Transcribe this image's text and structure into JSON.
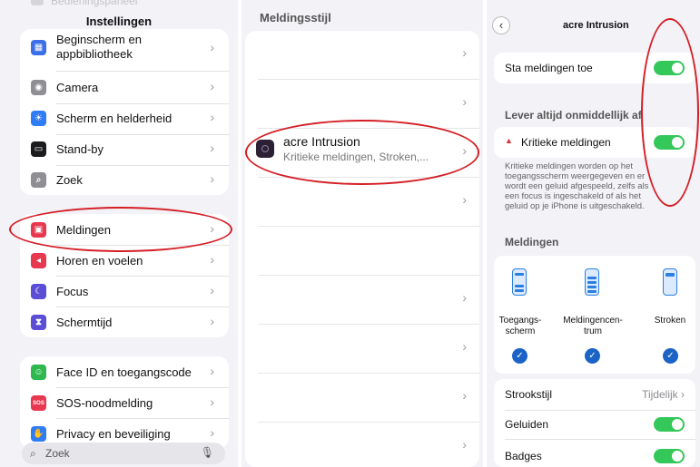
{
  "settings": {
    "ghost_item": "Bedieningspaneel",
    "title": "Instellingen",
    "group1": [
      {
        "label": "Beginscherm en appbibliotheek",
        "line1": "Beginscherm en",
        "line2": "appbibliotheek",
        "icon": "home-screen-icon",
        "color": "#3a6fe8"
      },
      {
        "label": "Camera",
        "icon": "camera-icon",
        "color": "#8e8e93"
      },
      {
        "label": "Scherm en helderheid",
        "icon": "brightness-icon",
        "color": "#2f7df6"
      },
      {
        "label": "Stand-by",
        "icon": "standby-icon",
        "color": "#1c1c1e"
      },
      {
        "label": "Zoek",
        "icon": "search-icon",
        "color": "#8e8e93"
      }
    ],
    "group2": [
      {
        "label": "Meldingen",
        "icon": "notifications-icon",
        "color": "#e8384f"
      },
      {
        "label": "Horen en voelen",
        "icon": "sound-icon",
        "color": "#e8384f"
      },
      {
        "label": "Focus",
        "icon": "moon-icon",
        "color": "#5b4ed6"
      },
      {
        "label": "Schermtijd",
        "icon": "hourglass-icon",
        "color": "#5b4ed6"
      }
    ],
    "group3": [
      {
        "label": "Face ID en toegangscode",
        "icon": "faceid-icon",
        "color": "#2fb84f"
      },
      {
        "label": "SOS-noodmelding",
        "icon": "sos-icon",
        "color": "#e8384f",
        "glyph": "SOS"
      },
      {
        "label": "Privacy en beveiliging",
        "icon": "hand-icon",
        "color": "#2f7df6"
      }
    ],
    "search_placeholder": "Zoek"
  },
  "notification_style": {
    "title": "Meldingsstijl",
    "app": {
      "name": "acre  Intrusion",
      "subtitle": "Kritieke meldingen, Stroken,..."
    }
  },
  "app_settings": {
    "title": "acre  Intrusion",
    "allow_label": "Sta meldingen toe",
    "deliver_header": "Lever altijd onmiddellijk af",
    "critical_label": "Kritieke meldingen",
    "critical_note_lines": [
      "Kritieke meldingen worden op het",
      "toegangsscherm weergegeven en er",
      "wordt een geluid afgespeeld, zelfs als",
      "een focus is ingeschakeld of als het",
      "geluid op je iPhone is uitgeschakeld."
    ],
    "notifications_header": "Meldingen",
    "styles": [
      {
        "label_line1": "Toegangs-",
        "label_line2": "scherm"
      },
      {
        "label_line1": "Meldingencen-",
        "label_line2": "trum"
      },
      {
        "label_line1": "Stroken",
        "label_line2": ""
      }
    ],
    "banner_style_label": "Strookstijl",
    "banner_style_value": "Tijdelijk",
    "sounds_label": "Geluiden",
    "badges_label": "Badges"
  },
  "colors": {
    "accent": "#34c759",
    "highlight": "#d41f26",
    "check": "#1c63c6"
  }
}
